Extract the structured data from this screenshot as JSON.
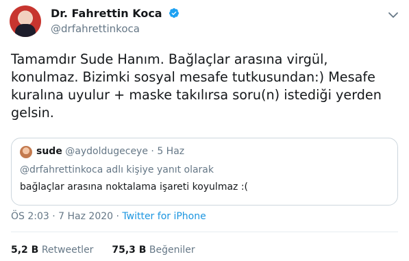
{
  "author": {
    "display_name": "Dr. Fahrettin Koca",
    "handle": "@drfahrettinkoca",
    "verified": true
  },
  "tweet": {
    "text_lines": [
      "Tamamdır Sude Hanım. Bağlaçlar arasına virgül,",
      "konulmaz. Bizimki sosyal mesafe tutkusundan:) Mesafe",
      "kuralına uyulur + maske takılırsa soru(n) istediği yerden",
      "gelsin."
    ]
  },
  "quote": {
    "name": "sude",
    "handle": "@aydoldugeceye",
    "separator": "·",
    "date": "5 Haz",
    "reply_to": "@drfahrettinkoca adlı kişiye yanıt olarak",
    "text": "bağlaçlar arasına noktalama işareti koyulmaz :("
  },
  "meta": {
    "time_date": "ÖS 2:03 · 7 Haz 2020 ·",
    "source": "Twitter for iPhone"
  },
  "stats": {
    "retweets_value": "5,2 B",
    "retweets_label": "Retweetler",
    "likes_value": "75,3 B",
    "likes_label": "Beğeniler"
  },
  "colors": {
    "link": "#1b95e0",
    "secondary_text": "#657786",
    "verified_badge": "#1da1f2"
  },
  "icons": {
    "verified": "verified-badge-icon",
    "more": "chevron-down-icon"
  }
}
